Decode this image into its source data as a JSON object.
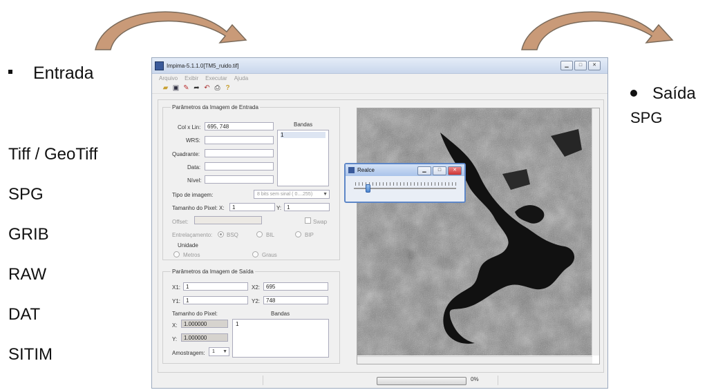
{
  "slide": {
    "left_heading": "Entrada",
    "input_formats": [
      "Tiff / GeoTiff",
      "SPG",
      "GRIB",
      "RAW",
      "DAT",
      "SITIM"
    ],
    "right_heading": "Saída",
    "right_format": "SPG",
    "arrow_color": "#c99a78"
  },
  "window": {
    "title": "Impima-5.1.1.0[TM5_ruido.tif]",
    "menu": [
      "Arquivo",
      "Exibir",
      "Executar",
      "Ajuda"
    ],
    "toolbar_icons": [
      "open-icon",
      "save-icon",
      "pencil-icon",
      "export-icon",
      "undo-icon",
      "print-icon",
      "help-icon"
    ],
    "input_group": {
      "legend": "Parâmetros da Imagem de Entrada",
      "col_lin_label": "Col x Lin:",
      "col_lin_value": "695, 748",
      "wrs_label": "WRS:",
      "quadrante_label": "Quadrante:",
      "data_label": "Data:",
      "nivel_label": "Nível:",
      "bandas_label": "Bandas",
      "bandas_items": [
        "1"
      ],
      "tipo_label": "Tipo de imagem:",
      "tipo_value": "8 bits sem sinal ( 0....255)",
      "tamanho_label": "Tamanho do Pixel: X:",
      "tamanho_x": "1",
      "tamanho_y_label": "Y:",
      "tamanho_y": "1",
      "offset_label": "Offset:",
      "swap_label": "Swap",
      "entrelacamento_label": "Entrelaçamento:",
      "entrelacamento_options": [
        "BSQ",
        "BIL",
        "BIP"
      ],
      "unidade_label": "Unidade",
      "unidade_options": [
        "Metros",
        "Graus"
      ]
    },
    "output_group": {
      "legend": "Parâmetros da Imagem de Saída",
      "x1_label": "X1:",
      "x1_value": "1",
      "x2_label": "X2:",
      "x2_value": "695",
      "y1_label": "Y1:",
      "y1_value": "1",
      "y2_label": "Y2:",
      "y2_value": "748",
      "tamanho_label": "Tamanho do Pixel:",
      "bandas_label": "Bandas",
      "x_label": "X:",
      "x_value": "1.000000",
      "y_label": "Y:",
      "y_value": "1.000000",
      "bandas_items": [
        "1"
      ],
      "amostragem_label": "Amostragem:",
      "amostragem_value": "1"
    },
    "status": {
      "progress_text": "0%",
      "progress": 0
    }
  },
  "dialog": {
    "title": "Realce",
    "slider_value": 0.1
  }
}
